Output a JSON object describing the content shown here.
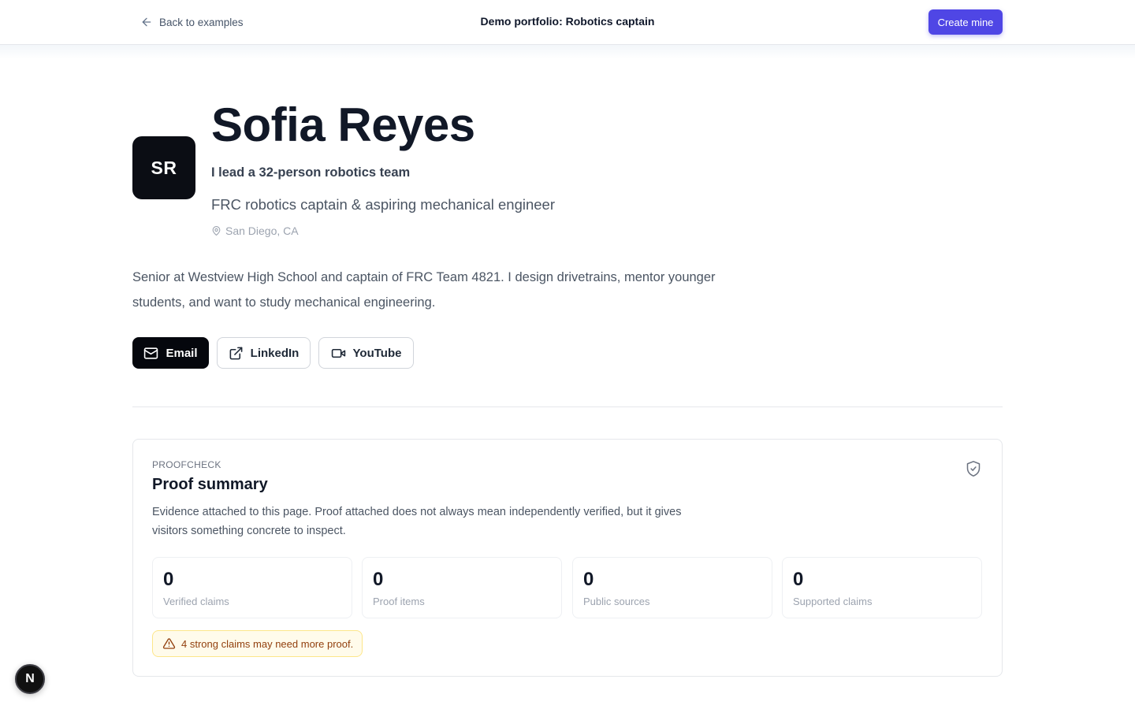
{
  "topbar": {
    "back_label": "Back to examples",
    "page_title": "Demo portfolio: Robotics captain",
    "create_label": "Create mine"
  },
  "profile": {
    "initials": "SR",
    "name": "Sofia Reyes",
    "tagline": "I lead a 32-person robotics team",
    "headline": "FRC robotics captain & aspiring mechanical engineer",
    "location": "San Diego, CA",
    "bio": "Senior at Westview High School and captain of FRC Team 4821. I design drivetrains, mentor younger students, and want to study mechanical engineering."
  },
  "contacts": {
    "email_label": "Email",
    "linkedin_label": "LinkedIn",
    "youtube_label": "YouTube"
  },
  "proof": {
    "eyebrow": "PROOFCHECK",
    "title": "Proof summary",
    "description": "Evidence attached to this page. Proof attached does not always mean independently verified, but it gives visitors something concrete to inspect.",
    "stats": [
      {
        "value": "0",
        "label": "Verified claims"
      },
      {
        "value": "0",
        "label": "Proof items"
      },
      {
        "value": "0",
        "label": "Public sources"
      },
      {
        "value": "0",
        "label": "Supported claims"
      }
    ],
    "warning": "4 strong claims may need more proof."
  },
  "badge": {
    "letter": "N"
  },
  "colors": {
    "accent": "#4f46e5",
    "dark": "#05070d",
    "warning_bg": "#fffbeb",
    "warning_text": "#92400e"
  },
  "icons": [
    "arrow-left-icon",
    "map-pin-icon",
    "mail-icon",
    "external-link-icon",
    "video-icon",
    "shield-check-icon",
    "alert-triangle-icon"
  ]
}
